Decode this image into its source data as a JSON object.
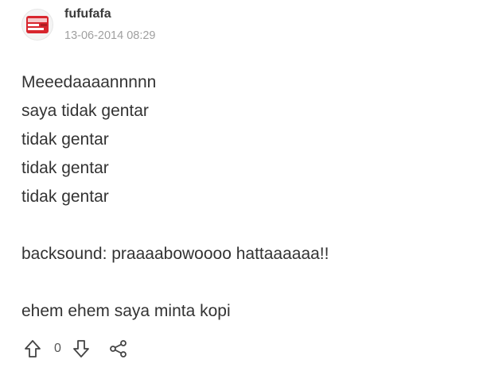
{
  "post": {
    "username": "fufufafa",
    "timestamp": "13-06-2014 08:29",
    "avatar_icon": "profile-avatar-image",
    "content_lines": [
      "Meeedaaaannnnn",
      "saya tidak gentar",
      "tidak gentar",
      "tidak gentar",
      "tidak gentar",
      "",
      "backsound: praaaabowoooo hattaaaaaa!!",
      "",
      "ehem ehem saya minta kopi"
    ]
  },
  "actions": {
    "upvote_icon": "upvote-arrow-icon",
    "vote_count": "0",
    "downvote_icon": "downvote-arrow-icon",
    "share_icon": "share-icon"
  },
  "colors": {
    "text": "#333333",
    "muted": "#a0a0a0",
    "icon": "#444444",
    "avatar_accent": "#d8262e"
  }
}
